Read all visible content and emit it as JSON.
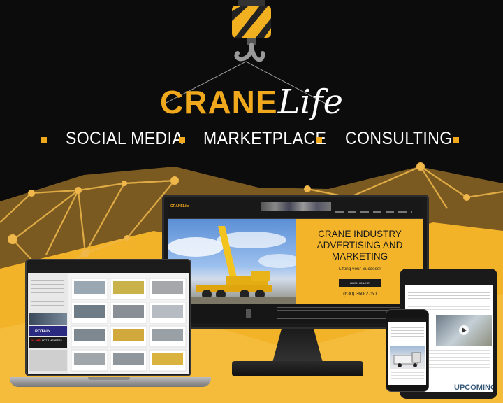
{
  "brand": {
    "crane": "CRANE",
    "life": "Life",
    "accent_color": "#f0a81c"
  },
  "services": [
    {
      "label": "SOCIAL MEDIA"
    },
    {
      "label": "MARKETPLACE"
    },
    {
      "label": "CONSULTING"
    }
  ],
  "monitor": {
    "headline_line1": "CRANE INDUSTRY",
    "headline_line2": "ADVERTISING AND",
    "headline_line3": "MARKETING",
    "subline": "Lifting your Success!",
    "button_label": "BOOK ONLINE",
    "phone": "(630) 360-2750",
    "nav_logo": "CRANELife"
  },
  "laptop": {
    "ad_brand_1": "POTAIN",
    "ad_brand_2": "SCRA",
    "ad_text_2": "NOT A MEMBER?"
  },
  "tablet": {
    "banner": "UPCOMING"
  }
}
